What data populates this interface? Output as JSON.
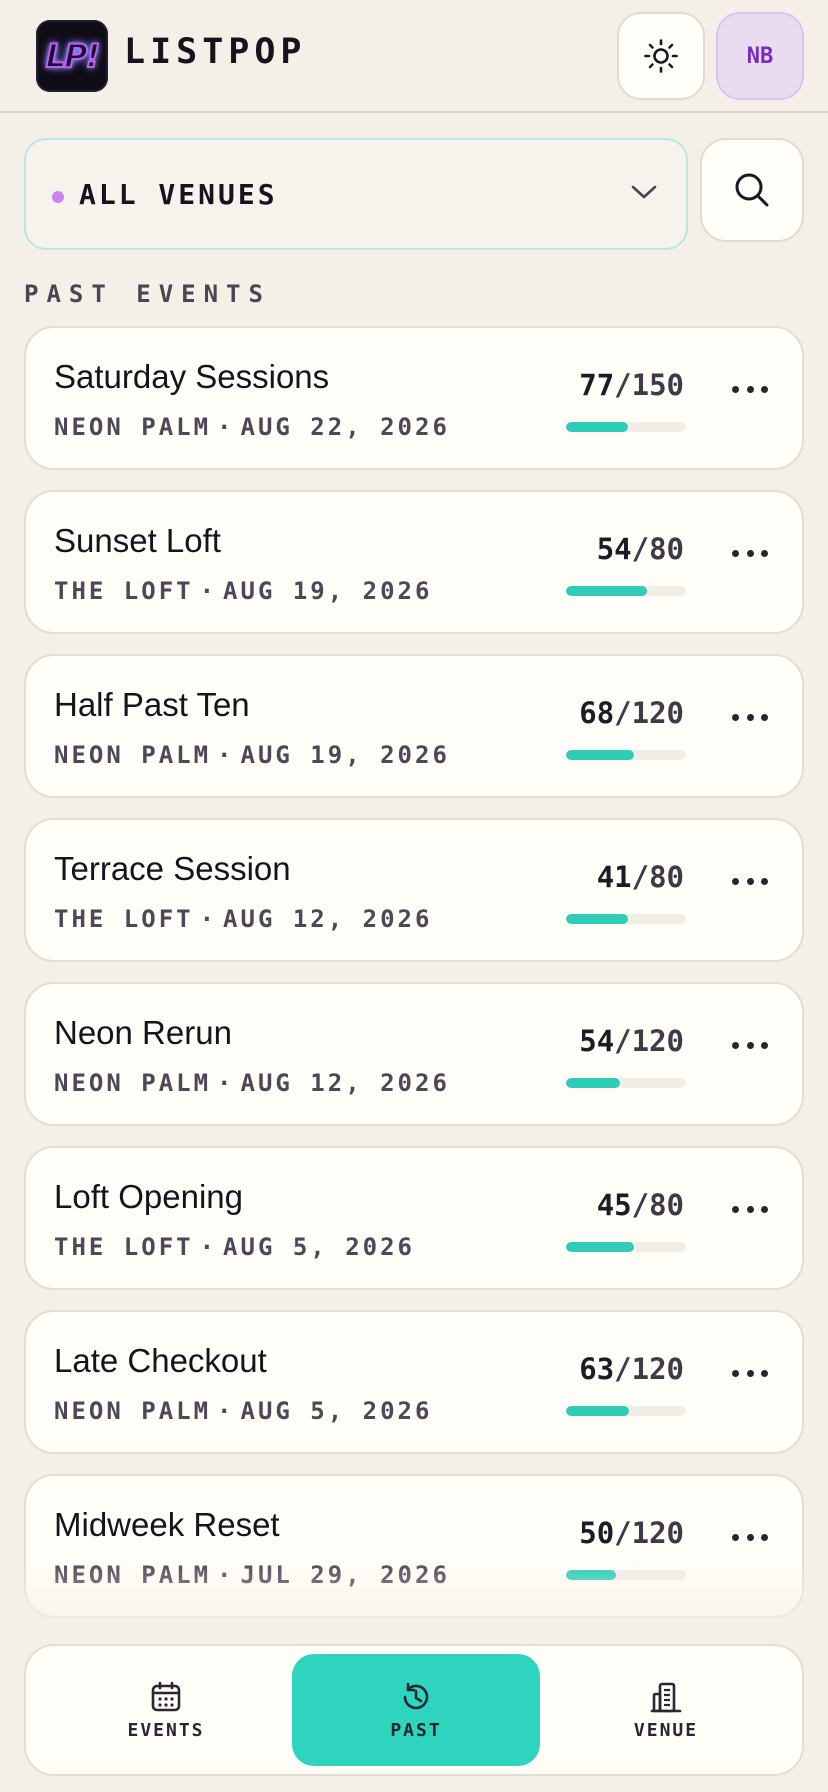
{
  "app": {
    "logo_text": "LP!",
    "brand": "LISTPOP",
    "avatar_initials": "NB"
  },
  "filter": {
    "venue_label": "ALL VENUES",
    "accent": "#c983f0"
  },
  "section_title": "PAST EVENTS",
  "events": [
    {
      "title": "Saturday Sessions",
      "venue": "NEON PALM",
      "sep": "·",
      "date": "AUG 22, 2026",
      "count": "77",
      "capacity": "/150",
      "fill": 0.513
    },
    {
      "title": "Sunset Loft",
      "venue": "THE LOFT",
      "sep": "·",
      "date": "AUG 19, 2026",
      "count": "54",
      "capacity": "/80",
      "fill": 0.675
    },
    {
      "title": "Half Past Ten",
      "venue": "NEON PALM",
      "sep": "·",
      "date": "AUG 19, 2026",
      "count": "68",
      "capacity": "/120",
      "fill": 0.567
    },
    {
      "title": "Terrace Session",
      "venue": "THE LOFT",
      "sep": "·",
      "date": "AUG 12, 2026",
      "count": "41",
      "capacity": "/80",
      "fill": 0.513
    },
    {
      "title": "Neon Rerun",
      "venue": "NEON PALM",
      "sep": "·",
      "date": "AUG 12, 2026",
      "count": "54",
      "capacity": "/120",
      "fill": 0.45
    },
    {
      "title": "Loft Opening",
      "venue": "THE LOFT",
      "sep": "·",
      "date": "AUG 5, 2026",
      "count": "45",
      "capacity": "/80",
      "fill": 0.5625
    },
    {
      "title": "Late Checkout",
      "venue": "NEON PALM",
      "sep": "·",
      "date": "AUG 5, 2026",
      "count": "63",
      "capacity": "/120",
      "fill": 0.525
    },
    {
      "title": "Midweek Reset",
      "venue": "NEON PALM",
      "sep": "·",
      "date": "JUL 29, 2026",
      "count": "50",
      "capacity": "/120",
      "fill": 0.417
    }
  ],
  "nav": {
    "items": [
      {
        "label": "EVENTS",
        "icon": "calendar-icon"
      },
      {
        "label": "PAST",
        "icon": "history-icon",
        "active": true
      },
      {
        "label": "VENUE",
        "icon": "building-icon"
      }
    ]
  },
  "colors": {
    "accent": "#2fd4bf",
    "background": "#f4f0e8",
    "card": "#fffdf7"
  }
}
